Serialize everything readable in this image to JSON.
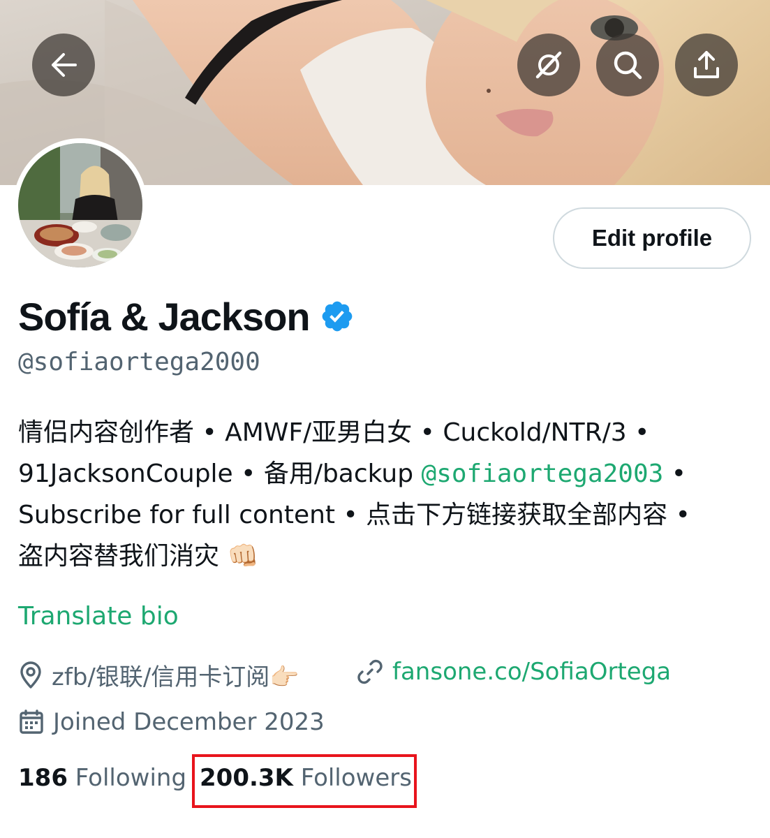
{
  "header": {
    "back_icon": "arrow-left-icon",
    "grok_icon": "grok-icon",
    "search_icon": "search-icon",
    "share_icon": "share-icon"
  },
  "profile": {
    "display_name": "Sofía & Jackson",
    "verified": true,
    "handle": "@sofiaortega2000",
    "edit_button_label": "Edit profile",
    "bio_lines": [
      {
        "text": "情侣内容创作者 • AMWF/亚男白女 • Cuckold/NTR/3 •"
      },
      {
        "before": "91JacksonCouple • 备用/backup ",
        "mention": "@sofiaortega2003",
        "after": " •"
      },
      {
        "text": "Subscribe for full content • 点击下方链接获取全部内容 •"
      },
      {
        "text": "盗内容替我们消灾 👊🏻"
      }
    ],
    "translate_label": "Translate bio",
    "location": "zfb/银联/信用卡订阅👉🏻",
    "website": "fansone.co/SofiaOrtega",
    "joined": "Joined December 2023",
    "following_count": "186",
    "following_label": "Following",
    "followers_count": "200.3K",
    "followers_label": "Followers"
  },
  "colors": {
    "accent": "#1da871",
    "verified": "#1d9bf0",
    "secondary_text": "#536471",
    "highlight": "#e8141c"
  }
}
